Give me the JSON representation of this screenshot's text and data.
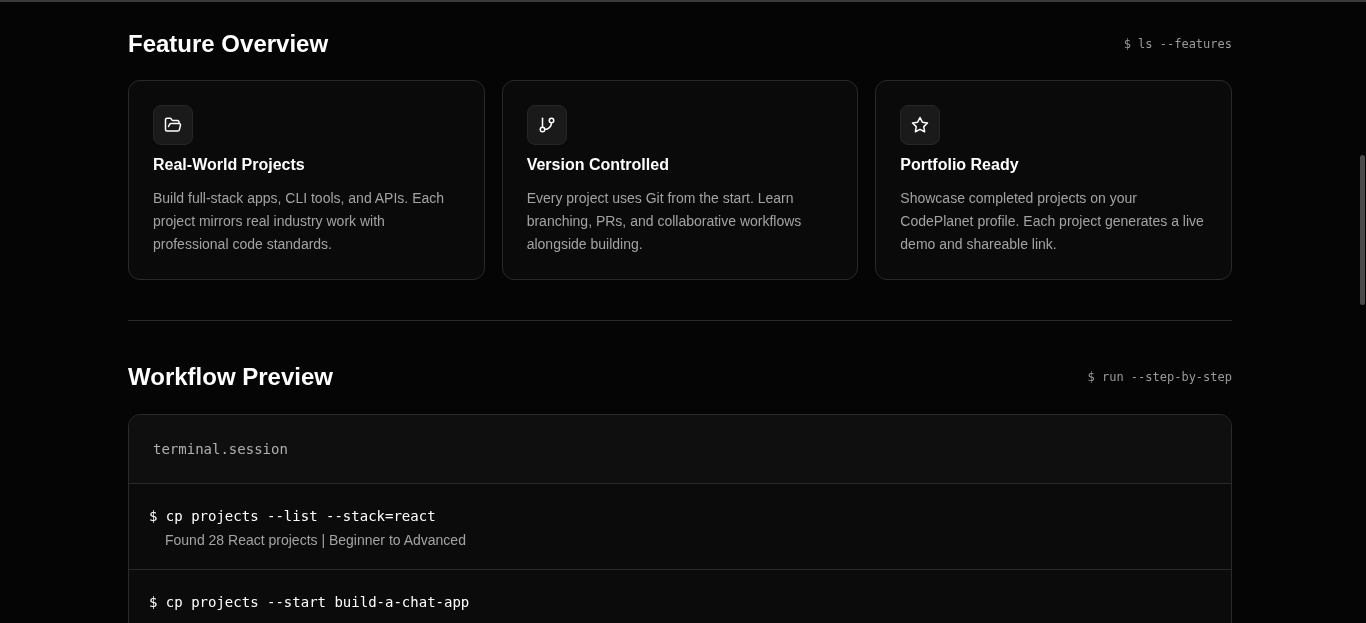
{
  "features": {
    "title": "Feature Overview",
    "command": "$ ls --features",
    "cards": [
      {
        "kind": "folder",
        "title": "Real-World Projects",
        "text": "Build full-stack apps, CLI tools, and APIs. Each project mirrors real industry work with professional code standards."
      },
      {
        "kind": "branch",
        "title": "Version Controlled",
        "text": "Every project uses Git from the start. Learn branching, PRs, and collaborative workflows alongside building."
      },
      {
        "kind": "star",
        "title": "Portfolio Ready",
        "text": "Showcase completed projects on your CodePlanet profile. Each project generates a live demo and shareable link."
      }
    ]
  },
  "workflow": {
    "title": "Workflow Preview",
    "command": "$ run --step-by-step",
    "terminal": {
      "title": "terminal.session",
      "steps": [
        {
          "command": "$ cp projects --list --stack=react",
          "output": "Found 28 React projects | Beginner to Advanced"
        },
        {
          "command": "$ cp projects --start build-a-chat-app"
        }
      ]
    }
  }
}
